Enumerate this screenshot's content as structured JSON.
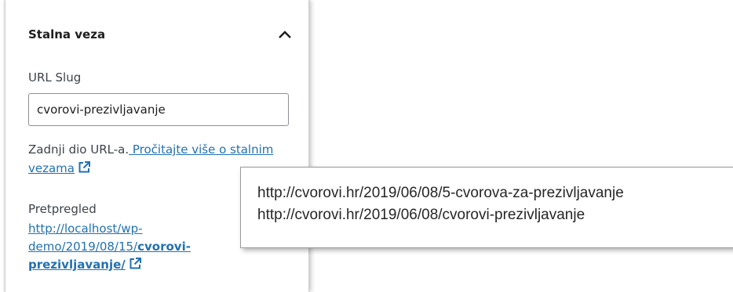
{
  "panel": {
    "title": "Stalna veza",
    "url_slug_label": "URL Slug",
    "url_slug_value": "cvorovi-prezivljavanje",
    "help_text": "Zadnji dio URL-a.",
    "help_link": " Pročitajte više o stalnim vezama",
    "preview_label": "Pretpregled",
    "preview_url_base": "http://localhost/wp-demo/2019/08/15/",
    "preview_url_slug": "cvorovi-prezivljavanje/",
    "icons": [
      "chevron-up-icon",
      "external-link-icon"
    ]
  },
  "callout": {
    "line1": "http://cvorovi.hr/2019/06/08/5-cvorova-za-prezivljavanje",
    "line2": "http://cvorovi.hr/2019/06/08/cvorovi-prezivljavanje"
  },
  "colors": {
    "link": "#2271b1",
    "text": "#1e1e1e",
    "muted": "#3c434a",
    "border": "#8c8f94"
  }
}
